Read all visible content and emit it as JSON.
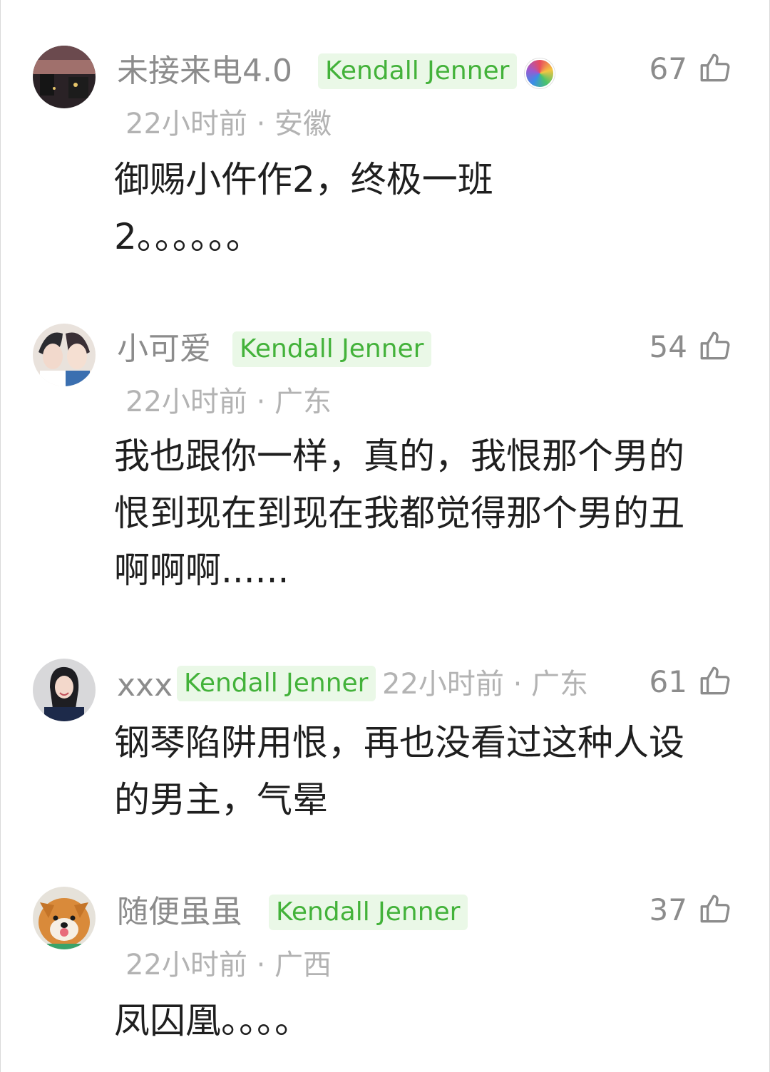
{
  "comments": [
    {
      "username": "未接来电4.0",
      "badge": "Kendall Jenner",
      "time_location": "22小时前 · 安徽",
      "text": "御赐小仵作2，终极一班2。。。。。。",
      "likes": "67"
    },
    {
      "username": "小可爱",
      "badge": "Kendall Jenner",
      "time_location": "22小时前 · 广东",
      "text": "我也跟你一样，真的，我恨那个男的恨到现在到现在我都觉得那个男的丑啊啊啊......",
      "likes": "54"
    },
    {
      "username": "xxx",
      "badge": "Kendall Jenner",
      "time_location": "22小时前 · 广东",
      "text": "钢琴陷阱用恨，再也没看过这种人设的男主，气晕",
      "likes": "61"
    },
    {
      "username": "随便虽虽",
      "badge": "Kendall Jenner",
      "time_location": "22小时前 · 广西",
      "text": "凤囚凰。。。。",
      "likes": "37"
    }
  ],
  "colors": {
    "username": "#8c8c8c",
    "badge_text": "#43b23a",
    "badge_bg": "#eaf8e7",
    "meta": "#b3b3b3",
    "body": "#1f1f1f"
  }
}
